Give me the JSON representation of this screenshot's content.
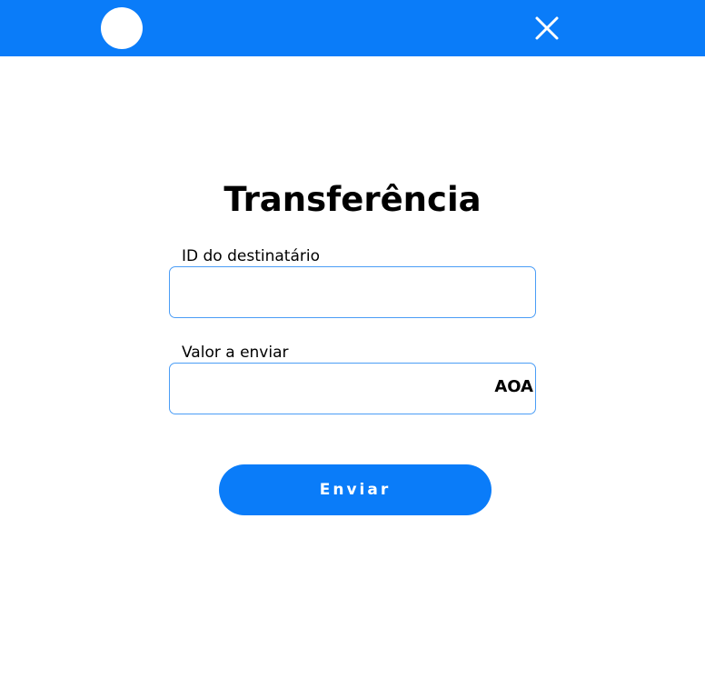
{
  "colors": {
    "primary": "#0a7cf9",
    "field_border": "#4b9df6",
    "background": "#ffffff"
  },
  "header": {
    "avatar_icon": "avatar-circle",
    "close_icon": "close-x"
  },
  "form": {
    "title": "Transferência",
    "recipient": {
      "label": "ID do destinatário",
      "value": "",
      "placeholder": ""
    },
    "amount": {
      "label": "Valor a enviar",
      "value": "",
      "placeholder": "",
      "currency": "AOA"
    },
    "submit_label": "Enviar"
  }
}
